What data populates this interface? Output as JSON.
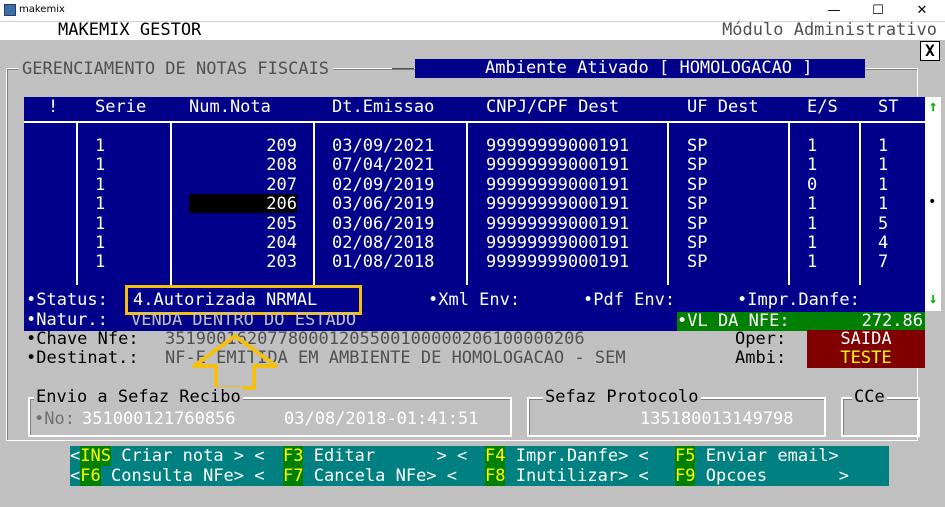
{
  "window": {
    "app_title": "makemix",
    "min_glyph": "—",
    "max_glyph": "☐",
    "close_glyph": "✕"
  },
  "header": {
    "left": "MAKEMIX GESTOR",
    "right": "Módulo Administrativo",
    "close_label": "X"
  },
  "section": {
    "title": "GERENCIAMENTO DE NOTAS FISCAIS",
    "ambiente": "Ambiente Ativado [ HOMOLOGACAO ]"
  },
  "table": {
    "columns": [
      "!",
      "Serie",
      "Num.Nota",
      "Dt.Emissao",
      "CNPJ/CPF Dest",
      "UF Dest",
      "E/S",
      "ST"
    ],
    "rows": [
      {
        "serie": "1",
        "num": "209",
        "dt": "03/09/2021",
        "cnpj": "99999999000191",
        "uf": "SP",
        "es": "1",
        "st": "1"
      },
      {
        "serie": "1",
        "num": "208",
        "dt": "07/04/2021",
        "cnpj": "99999999000191",
        "uf": "SP",
        "es": "1",
        "st": "1"
      },
      {
        "serie": "1",
        "num": "207",
        "dt": "02/09/2019",
        "cnpj": "99999999000191",
        "uf": "SP",
        "es": "0",
        "st": "1"
      },
      {
        "serie": "1",
        "num": "206",
        "dt": "03/06/2019",
        "cnpj": "99999999000191",
        "uf": "SP",
        "es": "1",
        "st": "1"
      },
      {
        "serie": "1",
        "num": "205",
        "dt": "03/06/2019",
        "cnpj": "99999999000191",
        "uf": "SP",
        "es": "1",
        "st": "5"
      },
      {
        "serie": "1",
        "num": "204",
        "dt": "02/08/2018",
        "cnpj": "99999999000191",
        "uf": "SP",
        "es": "1",
        "st": "4"
      },
      {
        "serie": "1",
        "num": "203",
        "dt": "01/08/2018",
        "cnpj": "99999999000191",
        "uf": "SP",
        "es": "1",
        "st": "7"
      }
    ],
    "selected_index": 3,
    "scroll_up": "↑",
    "scroll_down": "↓",
    "scroll_thumb": "•"
  },
  "info": {
    "status_label": "•Status:",
    "status_value": "4.Autorizada NRMAL",
    "xml_label": "•Xml Env:",
    "pdf_label": "•Pdf Env:",
    "impr_label": "•Impr.Danfe:",
    "natur_label": "•Natur.:",
    "natur_value": "VENDA DENTRO DO ESTADO",
    "vl_label": "•VL DA NFE:",
    "vl_value": "272.86",
    "chave_label": "•Chave Nfe:",
    "chave_value": "35190016207780001205500100000206100000206",
    "oper_label": "Oper:",
    "oper_value": "SAIDA",
    "destinat_label": "•Destinat.:",
    "destinat_value": "NF-E EMITIDA EM AMBIENTE DE HOMOLOGACAO - SEM",
    "ambi_label": "Ambi:",
    "ambi_value": "TESTE"
  },
  "envio": {
    "title": "Envio a Sefaz Recibo",
    "no_label": "•No:",
    "no_value": "351000121760856",
    "datetime": "03/08/2018-01:41:51"
  },
  "protocolo": {
    "title": "Sefaz Protocolo",
    "value": "135180013149798"
  },
  "cce": {
    "title": "CCe"
  },
  "menu": {
    "row1": [
      {
        "key": "INS",
        "label": " Criar nota > <"
      },
      {
        "key": "F3",
        "label": " Editar      > <"
      },
      {
        "key": "F4",
        "label": " Impr.Danfe> <"
      },
      {
        "key": "F5",
        "label": " Enviar email>"
      }
    ],
    "row2": [
      {
        "key": "F6",
        "label": " Consulta NFe> <"
      },
      {
        "key": "F7",
        "label": " Cancela NFe> <"
      },
      {
        "key": "F8",
        "label": " Inutilizar> <"
      },
      {
        "key": "F9",
        "label": " Opcoes       >"
      }
    ],
    "lead": "<"
  },
  "colors": {
    "panel_blue": "#00008b",
    "highlight_yellow": "#f3c012",
    "menu_teal": "#008080",
    "key_green": "#008000",
    "key_yellow": "#ffff00",
    "alert_red": "#800000"
  }
}
